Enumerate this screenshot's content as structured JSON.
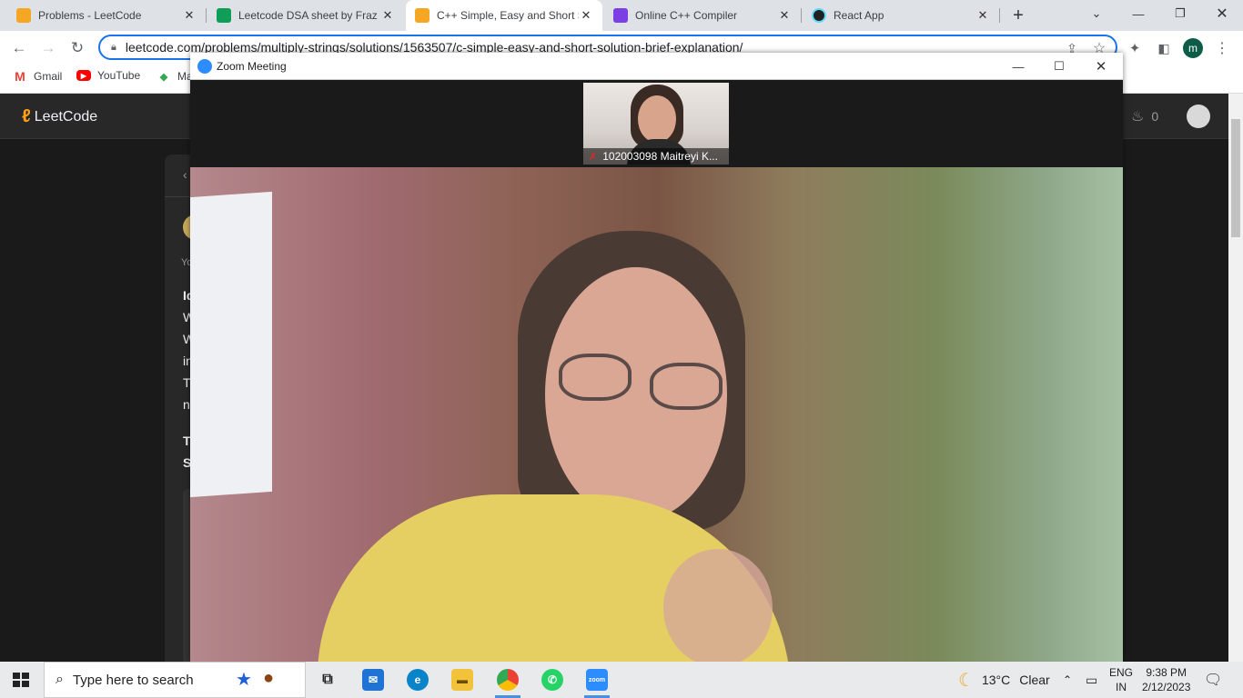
{
  "browser": {
    "tabs": [
      {
        "title": "Problems - LeetCode",
        "favicon_color": "#f5a623",
        "active": false
      },
      {
        "title": "Leetcode DSA sheet by Fraz",
        "favicon_color": "#0f9d58",
        "active": false
      },
      {
        "title": "C++ Simple, Easy and Short S",
        "favicon_color": "#f5a623",
        "active": true
      },
      {
        "title": "Online C++ Compiler",
        "favicon_color": "#7b3fe4",
        "active": false
      },
      {
        "title": "React App",
        "favicon_color": "#61dafb",
        "active": false
      }
    ],
    "new_tab_glyph": "+",
    "url": "leetcode.com/problems/multiply-strings/solutions/1563507/c-simple-easy-and-short-solution-brief-explanation/",
    "profile_initial": "m",
    "bookmarks": [
      {
        "label": "Gmail",
        "icon": "gmail-icon"
      },
      {
        "label": "YouTube",
        "icon": "youtube-icon"
      },
      {
        "label": "Ma",
        "icon": "maps-icon"
      }
    ]
  },
  "leetcode": {
    "logo_text": "LeetCode",
    "streak_count": "0",
    "partial_letters": [
      "Yo",
      "Id",
      "W",
      "W",
      "in",
      "T",
      "n",
      "T",
      "S"
    ]
  },
  "zoom": {
    "window_title": "Zoom Meeting",
    "participant_label": "102003098 Maitreyi K...",
    "accent": "#2d8cff"
  },
  "taskbar": {
    "search_placeholder": "Type here to search",
    "weather_temp": "13°C",
    "weather_text": "Clear",
    "lang_top": "ENG",
    "lang_bottom": "IN",
    "time": "9:38 PM",
    "date": "2/12/2023"
  }
}
